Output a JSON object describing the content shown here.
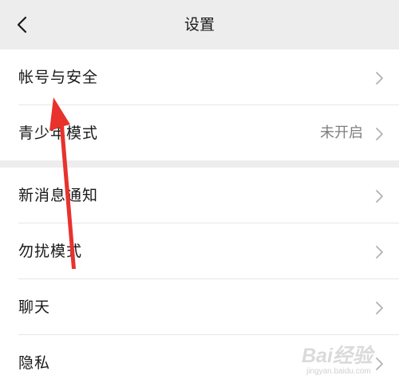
{
  "header": {
    "title": "设置",
    "back_icon": "chevron-left-icon"
  },
  "group1": {
    "items": [
      {
        "label": "帐号与安全",
        "value": ""
      },
      {
        "label": "青少年模式",
        "value": "未开启"
      }
    ]
  },
  "group2": {
    "items": [
      {
        "label": "新消息通知",
        "value": ""
      },
      {
        "label": "勿扰模式",
        "value": ""
      },
      {
        "label": "聊天",
        "value": ""
      },
      {
        "label": "隐私",
        "value": ""
      }
    ]
  },
  "annotation": {
    "arrow_color": "#e8322c"
  },
  "watermark": {
    "text": "Bai经验",
    "sub": "jingyan.baidu.com"
  }
}
